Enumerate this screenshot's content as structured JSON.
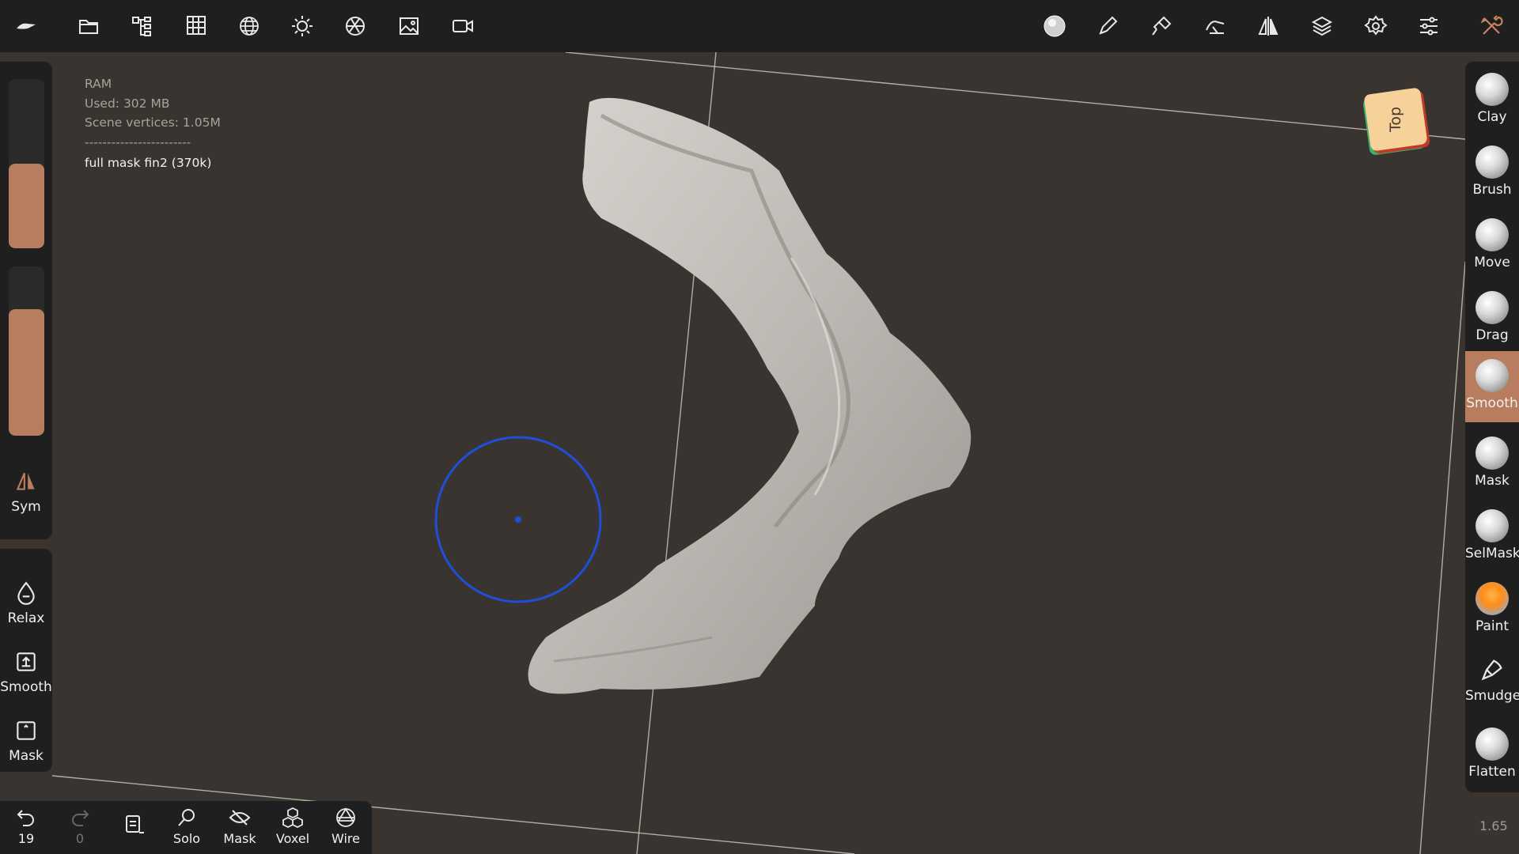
{
  "toolbar": {
    "left_icons": [
      "logo-icon",
      "folder-icon",
      "scene-tree-icon",
      "grid-topology-icon",
      "mesh-sphere-icon",
      "light-sun-icon",
      "material-shading-icon",
      "background-image-icon",
      "camera-icon"
    ],
    "right_icons": [
      "current-brush-icon",
      "stroke-pencil-icon",
      "paint-brush-icon",
      "hand-gesture-icon",
      "symmetry-icon",
      "layers-icon",
      "settings-gear-icon",
      "sliders-menu-icon",
      "tools-wrench-icon"
    ]
  },
  "info": {
    "ram_label": "RAM",
    "used": "Used: 302 MB",
    "vertices": "Scene vertices: 1.05M",
    "separator": "------------------------",
    "model_name": "full mask fin2 (370k)"
  },
  "left_panel": {
    "radius_fill_fraction": 0.5,
    "intensity_fill_fraction": 0.75,
    "sym_label": "Sym",
    "relax_label": "Relax",
    "smooth_label": "Smooth",
    "mask_label": "Mask"
  },
  "tools": [
    {
      "label": "Clay",
      "active": false
    },
    {
      "label": "Brush",
      "active": false
    },
    {
      "label": "Move",
      "active": false
    },
    {
      "label": "Drag",
      "active": false
    },
    {
      "label": "Smooth",
      "active": true
    },
    {
      "label": "Mask",
      "active": false
    },
    {
      "label": "SelMask",
      "active": false
    },
    {
      "label": "Paint",
      "active": false
    },
    {
      "label": "Smudge",
      "active": false
    },
    {
      "label": "Flatten",
      "active": false
    }
  ],
  "bottom_bar": {
    "undo_count": "19",
    "redo_count": "0",
    "solo_label": "Solo",
    "mask_label": "Mask",
    "voxel_label": "Voxel",
    "wire_label": "Wire"
  },
  "view_cube": {
    "label": "Top"
  },
  "zoom": "1.65",
  "colors": {
    "accent": "#b87c5e",
    "panel": "#1f1f1f",
    "viewport": "#3a3430",
    "cursor": "#1f4fd8"
  }
}
